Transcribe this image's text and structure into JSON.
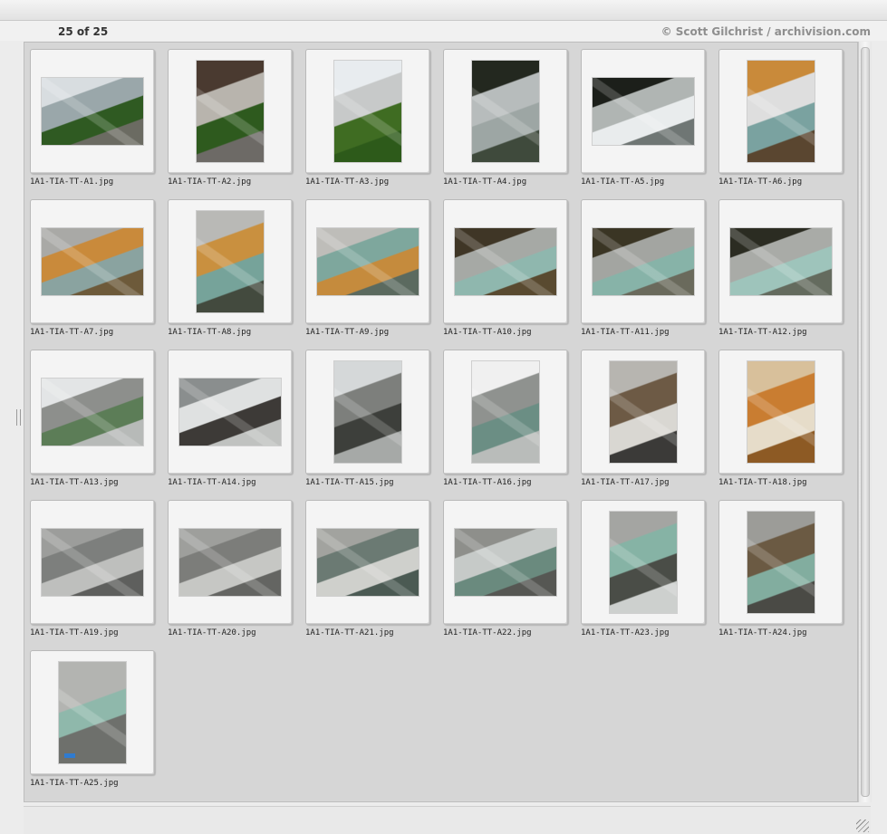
{
  "header": {
    "counter": "25 of 25",
    "credit": "© Scott Gilchrist / archivision.com"
  },
  "thumbnails": [
    {
      "filename": "1A1-TIA-TT-A1.jpg",
      "orientation": "landscape",
      "palette": [
        "#d8dde0",
        "#9aa7aa",
        "#2f5a22",
        "#6b6b62"
      ]
    },
    {
      "filename": "1A1-TIA-TT-A2.jpg",
      "orientation": "portrait",
      "palette": [
        "#4a3a30",
        "#b8b4ad",
        "#2e5a1e",
        "#6d6a66"
      ]
    },
    {
      "filename": "1A1-TIA-TT-A3.jpg",
      "orientation": "portrait",
      "palette": [
        "#e8ecef",
        "#c7c9c9",
        "#3f6c22",
        "#2d5a1a"
      ]
    },
    {
      "filename": "1A1-TIA-TT-A4.jpg",
      "orientation": "portrait",
      "palette": [
        "#23281f",
        "#b7bcbc",
        "#9da6a4",
        "#3f4a3c"
      ]
    },
    {
      "filename": "1A1-TIA-TT-A5.jpg",
      "orientation": "landscape",
      "palette": [
        "#1c1f1a",
        "#b0b5b3",
        "#e9eced",
        "#6f7674"
      ]
    },
    {
      "filename": "1A1-TIA-TT-A6.jpg",
      "orientation": "portrait",
      "palette": [
        "#c98a3a",
        "#dedede",
        "#7aa2a0",
        "#5a4630"
      ]
    },
    {
      "filename": "1A1-TIA-TT-A7.jpg",
      "orientation": "landscape",
      "palette": [
        "#a9a9a6",
        "#c98a3b",
        "#8aa3a0",
        "#6d5a3a"
      ]
    },
    {
      "filename": "1A1-TIA-TT-A8.jpg",
      "orientation": "portrait",
      "palette": [
        "#b9b9b6",
        "#c9903f",
        "#76a39a",
        "#434a3e"
      ]
    },
    {
      "filename": "1A1-TIA-TT-A9.jpg",
      "orientation": "landscape",
      "palette": [
        "#bebdb9",
        "#7ea79d",
        "#c58b3d",
        "#5b6a5f"
      ]
    },
    {
      "filename": "1A1-TIA-TT-A10.jpg",
      "orientation": "landscape",
      "palette": [
        "#3f3626",
        "#a6a9a5",
        "#8fb7ae",
        "#594a30"
      ]
    },
    {
      "filename": "1A1-TIA-TT-A11.jpg",
      "orientation": "landscape",
      "palette": [
        "#3a3524",
        "#a3a5a1",
        "#87b3a8",
        "#6a6a5c"
      ]
    },
    {
      "filename": "1A1-TIA-TT-A12.jpg",
      "orientation": "landscape",
      "palette": [
        "#2b2c22",
        "#a9aba7",
        "#9ec4bb",
        "#646b5e"
      ]
    },
    {
      "filename": "1A1-TIA-TT-A13.jpg",
      "orientation": "landscape",
      "palette": [
        "#e3e5e6",
        "#8d8f8c",
        "#5c7d57",
        "#b7bab8"
      ]
    },
    {
      "filename": "1A1-TIA-TT-A14.jpg",
      "orientation": "landscape",
      "palette": [
        "#8a8e8e",
        "#dfe1e1",
        "#3d3a37",
        "#c0c2c0"
      ]
    },
    {
      "filename": "1A1-TIA-TT-A15.jpg",
      "orientation": "portrait",
      "palette": [
        "#d5d8d9",
        "#7d7f7c",
        "#3d3f3b",
        "#a6a9a7"
      ]
    },
    {
      "filename": "1A1-TIA-TT-A16.jpg",
      "orientation": "portrait",
      "palette": [
        "#f0f0f0",
        "#8f928f",
        "#6b8e84",
        "#b9bcba"
      ]
    },
    {
      "filename": "1A1-TIA-TT-A17.jpg",
      "orientation": "portrait",
      "palette": [
        "#b7b5b0",
        "#6d5a45",
        "#d9d7d2",
        "#3b3a38"
      ]
    },
    {
      "filename": "1A1-TIA-TT-A18.jpg",
      "orientation": "portrait",
      "palette": [
        "#d8c09b",
        "#c97d31",
        "#e6dcc9",
        "#8d5a24"
      ]
    },
    {
      "filename": "1A1-TIA-TT-A19.jpg",
      "orientation": "landscape",
      "palette": [
        "#9c9d9b",
        "#7d7f7d",
        "#bebfbd",
        "#5e5f5d"
      ]
    },
    {
      "filename": "1A1-TIA-TT-A20.jpg",
      "orientation": "landscape",
      "palette": [
        "#9e9f9c",
        "#7c7d7a",
        "#c6c7c4",
        "#646562"
      ]
    },
    {
      "filename": "1A1-TIA-TT-A21.jpg",
      "orientation": "landscape",
      "palette": [
        "#a2a39f",
        "#6b7a73",
        "#cfd0cc",
        "#4b5a53"
      ]
    },
    {
      "filename": "1A1-TIA-TT-A22.jpg",
      "orientation": "landscape",
      "palette": [
        "#8e8f8b",
        "#c6cac8",
        "#6a8a7e",
        "#565753"
      ]
    },
    {
      "filename": "1A1-TIA-TT-A23.jpg",
      "orientation": "portrait",
      "palette": [
        "#a4a5a2",
        "#86b3a5",
        "#4a4d47",
        "#cdd0ce"
      ]
    },
    {
      "filename": "1A1-TIA-TT-A24.jpg",
      "orientation": "portrait",
      "palette": [
        "#9c9c98",
        "#6b5a43",
        "#82ad9f",
        "#4a4a45"
      ]
    },
    {
      "filename": "1A1-TIA-TT-A25.jpg",
      "orientation": "portrait",
      "palette": [
        "#b3b4b1",
        "#8fb8ab",
        "#6e706c",
        "#2f7bd0"
      ]
    }
  ]
}
